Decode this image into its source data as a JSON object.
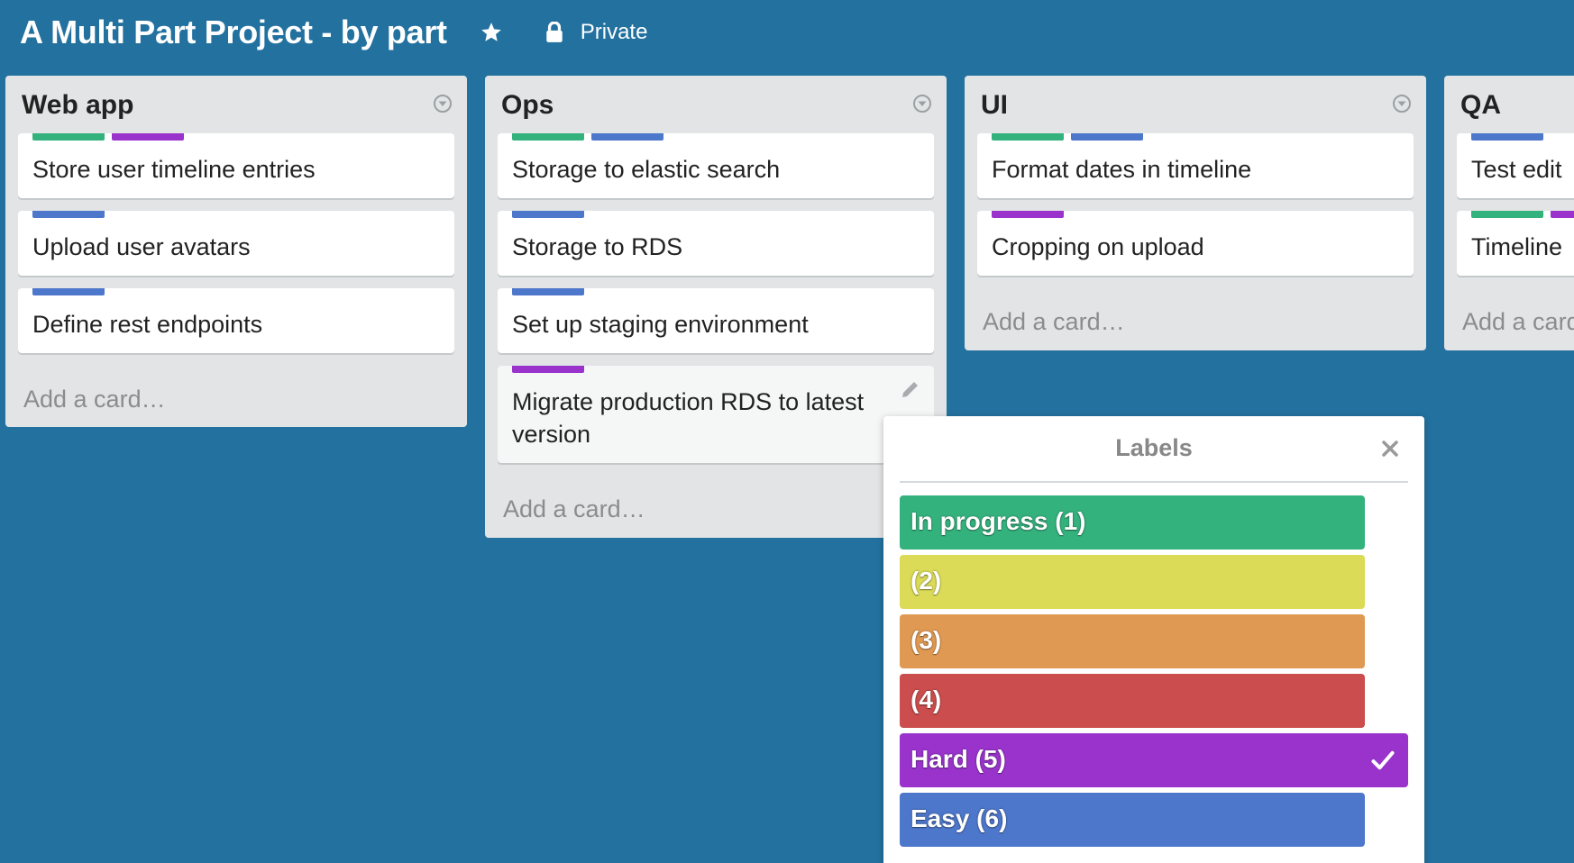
{
  "board": {
    "title": "A Multi Part Project - by part",
    "visibility": "Private",
    "background_color": "#23719f"
  },
  "label_colors": {
    "green": "#34b27d",
    "yellow": "#dbdb57",
    "orange": "#e09952",
    "red": "#cb4d4d",
    "purple": "#9933cc",
    "blue": "#4d77cb"
  },
  "lists": [
    {
      "title": "Web app",
      "cards": [
        {
          "title": "Store user timeline entries",
          "labels": [
            "green",
            "purple"
          ]
        },
        {
          "title": "Upload user avatars",
          "labels": [
            "blue"
          ]
        },
        {
          "title": "Define rest endpoints",
          "labels": [
            "blue"
          ]
        }
      ],
      "add_card": "Add a card…"
    },
    {
      "title": "Ops",
      "cards": [
        {
          "title": "Storage to elastic search",
          "labels": [
            "green",
            "blue"
          ]
        },
        {
          "title": "Storage to RDS",
          "labels": [
            "blue"
          ]
        },
        {
          "title": "Set up staging environment",
          "labels": [
            "blue"
          ]
        },
        {
          "title": "Migrate production RDS to latest version",
          "labels": [
            "purple"
          ],
          "hovered": true
        }
      ],
      "add_card": "Add a card…"
    },
    {
      "title": "UI",
      "cards": [
        {
          "title": "Format dates in timeline",
          "labels": [
            "green",
            "blue"
          ]
        },
        {
          "title": "Cropping on upload",
          "labels": [
            "purple"
          ]
        }
      ],
      "add_card": "Add a card…"
    },
    {
      "title": "QA",
      "cards": [
        {
          "title": "Test edit",
          "labels": [
            "blue"
          ]
        },
        {
          "title": "Timeline",
          "labels": [
            "green",
            "purple"
          ]
        }
      ],
      "add_card": "Add a card…"
    }
  ],
  "labels_popover": {
    "title": "Labels",
    "options": [
      {
        "text": "In progress (1)",
        "color": "green",
        "selected": false
      },
      {
        "text": "(2)",
        "color": "yellow",
        "selected": false
      },
      {
        "text": "(3)",
        "color": "orange",
        "selected": false
      },
      {
        "text": "(4)",
        "color": "red",
        "selected": false
      },
      {
        "text": "Hard (5)",
        "color": "purple",
        "selected": true
      },
      {
        "text": "Easy (6)",
        "color": "blue",
        "selected": false
      }
    ]
  },
  "icons": {
    "star": "star-icon",
    "lock": "lock-icon",
    "list_menu": "chevron-down-circle-icon",
    "edit": "pencil-icon",
    "close": "close-icon",
    "check": "check-icon"
  }
}
